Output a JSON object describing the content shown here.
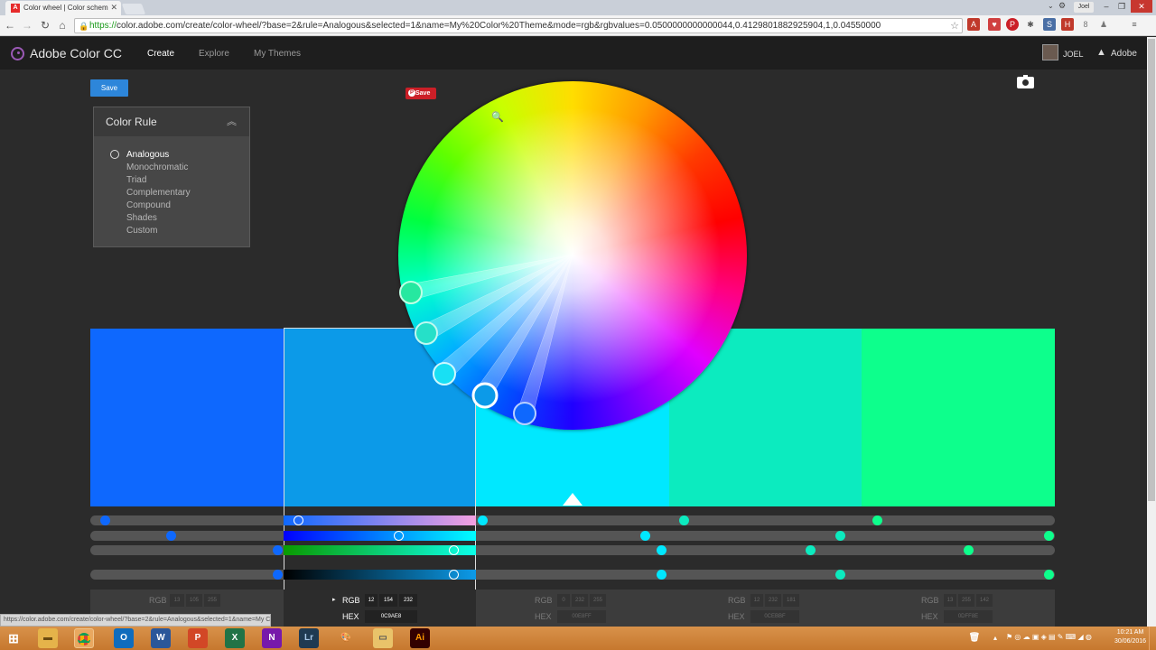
{
  "browser": {
    "tab_title": "Color wheel | Color schem",
    "url_scheme": "https://",
    "url_rest": "color.adobe.com/create/color-wheel/?base=2&rule=Analogous&selected=1&name=My%20Color%20Theme&mode=rgb&rgbvalues=0.0500000000000044,0.4129801882925904,1,0.04550000",
    "profile": "Joel",
    "status_url": "https://color.adobe.com/create/color-wheel/?base=2&rule=Analogous&selected=1&name=My Color Theme&mode=..."
  },
  "app": {
    "brand": "Adobe Color CC",
    "nav": [
      "Create",
      "Explore",
      "My Themes"
    ],
    "user": "JOEL",
    "adobe": "Adobe",
    "save_label": "Save",
    "pinterest_label": "Save"
  },
  "color_rule": {
    "title": "Color Rule",
    "options": [
      "Analogous",
      "Monochromatic",
      "Triad",
      "Complementary",
      "Compound",
      "Shades",
      "Custom"
    ],
    "selected": "Analogous"
  },
  "swatches": [
    "#0e68fe",
    "#0c9ae8",
    "#00e8ff",
    "#0cebbf",
    "#0dff8c"
  ],
  "values": [
    {
      "mode": "RGB",
      "rgb": [
        "13",
        "105",
        "255"
      ],
      "hex_label": "HEX",
      "hex": ""
    },
    {
      "mode": "RGB",
      "rgb": [
        "12",
        "154",
        "232"
      ],
      "hex_label": "HEX",
      "hex": "0C9AE8"
    },
    {
      "mode": "RGB",
      "rgb": [
        "0",
        "232",
        "255"
      ],
      "hex_label": "HEX",
      "hex": "00E8FF"
    },
    {
      "mode": "RGB",
      "rgb": [
        "12",
        "232",
        "181"
      ],
      "hex_label": "HEX",
      "hex": "0CEBBF"
    },
    {
      "mode": "RGB",
      "rgb": [
        "13",
        "255",
        "142"
      ],
      "hex_label": "HEX",
      "hex": "0DFF8E"
    }
  ],
  "taskbar": {
    "time": "10:21 AM",
    "date": "30/06/2016"
  },
  "colors": {
    "accent": "#2d86da",
    "brand": "#9b59b6",
    "pinterest": "#cb1f27"
  }
}
